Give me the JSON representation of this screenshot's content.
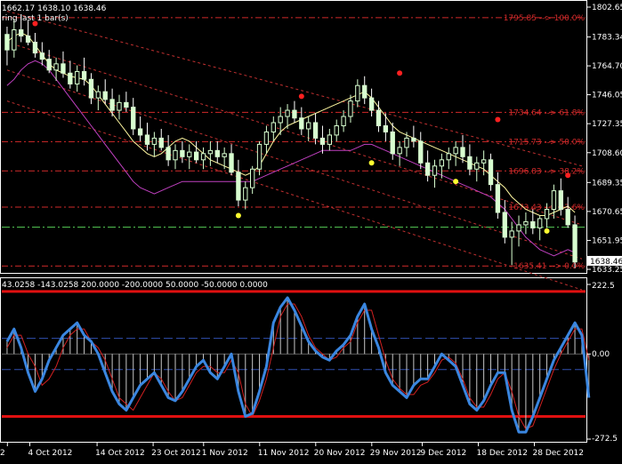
{
  "chart_data": [
    {
      "type": "candlestick",
      "header": "1662.17 1638.10 1638.46",
      "header2": "ring last 1 bar(s)",
      "y_ticks": [
        "1802.65",
        "1783.34",
        "1764.70",
        "1746.05",
        "1727.35",
        "1708.60",
        "1689.35",
        "1670.65",
        "1651.95",
        "1633.25"
      ],
      "ylim": [
        1633.25,
        1802.65
      ],
      "last_price": "1638.46",
      "colors": {
        "up": "#d8ffd0",
        "down": "#ffffff",
        "fib": "#d12a2a",
        "signal_red": "#ff2020",
        "signal_yellow": "#ffff30",
        "ma_purple": "#c040c0",
        "ma_yellow": "#fff8a0",
        "channel": "#c03030",
        "hline_green": "#50c050"
      },
      "fib_levels": [
        {
          "label": "1795.85 --> 100.0%",
          "value": 1795.85
        },
        {
          "label": "1734.64 --> 61.8%",
          "value": 1734.64
        },
        {
          "label": "1715.73 --> 50.0%",
          "value": 1715.73
        },
        {
          "label": "1696.83 --> 38.2%",
          "value": 1696.83
        },
        {
          "label": "1673.43 --> 23.6%",
          "value": 1673.43
        },
        {
          "label": "1635.41 --> 0.0%",
          "value": 1635.41
        }
      ],
      "hline_value": 1660.5,
      "candles": [
        [
          1785,
          1790,
          1765,
          1775
        ],
        [
          1775,
          1795,
          1770,
          1788
        ],
        [
          1788,
          1798,
          1780,
          1784
        ],
        [
          1784,
          1794,
          1778,
          1780
        ],
        [
          1780,
          1786,
          1770,
          1773
        ],
        [
          1773,
          1780,
          1765,
          1769
        ],
        [
          1769,
          1775,
          1760,
          1762
        ],
        [
          1762,
          1770,
          1755,
          1766
        ],
        [
          1766,
          1774,
          1757,
          1760
        ],
        [
          1760,
          1768,
          1750,
          1753
        ],
        [
          1753,
          1765,
          1748,
          1761
        ],
        [
          1761,
          1770,
          1752,
          1756
        ],
        [
          1756,
          1760,
          1740,
          1744
        ],
        [
          1744,
          1752,
          1736,
          1748
        ],
        [
          1748,
          1756,
          1740,
          1743
        ],
        [
          1743,
          1750,
          1732,
          1736
        ],
        [
          1736,
          1746,
          1730,
          1741
        ],
        [
          1741,
          1748,
          1735,
          1738
        ],
        [
          1738,
          1744,
          1720,
          1724
        ],
        [
          1724,
          1732,
          1716,
          1720
        ],
        [
          1720,
          1728,
          1710,
          1714
        ],
        [
          1714,
          1722,
          1706,
          1718
        ],
        [
          1718,
          1724,
          1710,
          1712
        ],
        [
          1712,
          1720,
          1700,
          1704
        ],
        [
          1704,
          1714,
          1698,
          1710
        ],
        [
          1710,
          1716,
          1702,
          1706
        ],
        [
          1706,
          1714,
          1698,
          1709
        ],
        [
          1709,
          1716,
          1702,
          1704
        ],
        [
          1704,
          1712,
          1698,
          1708
        ],
        [
          1708,
          1716,
          1700,
          1710
        ],
        [
          1710,
          1716,
          1702,
          1706
        ],
        [
          1706,
          1712,
          1698,
          1708
        ],
        [
          1708,
          1714,
          1694,
          1696
        ],
        [
          1696,
          1704,
          1674,
          1678
        ],
        [
          1678,
          1690,
          1672,
          1686
        ],
        [
          1686,
          1700,
          1682,
          1698
        ],
        [
          1698,
          1716,
          1694,
          1714
        ],
        [
          1714,
          1726,
          1708,
          1722
        ],
        [
          1722,
          1732,
          1716,
          1728
        ],
        [
          1728,
          1738,
          1720,
          1732
        ],
        [
          1732,
          1740,
          1724,
          1736
        ],
        [
          1736,
          1742,
          1728,
          1731
        ],
        [
          1731,
          1738,
          1720,
          1724
        ],
        [
          1724,
          1732,
          1716,
          1728
        ],
        [
          1728,
          1734,
          1714,
          1718
        ],
        [
          1718,
          1726,
          1708,
          1714
        ],
        [
          1714,
          1724,
          1710,
          1720
        ],
        [
          1720,
          1730,
          1716,
          1726
        ],
        [
          1726,
          1736,
          1722,
          1732
        ],
        [
          1732,
          1746,
          1728,
          1742
        ],
        [
          1742,
          1756,
          1738,
          1752
        ],
        [
          1752,
          1758,
          1740,
          1744
        ],
        [
          1744,
          1750,
          1732,
          1736
        ],
        [
          1736,
          1742,
          1722,
          1726
        ],
        [
          1726,
          1734,
          1716,
          1722
        ],
        [
          1722,
          1728,
          1704,
          1708
        ],
        [
          1708,
          1716,
          1700,
          1712
        ],
        [
          1712,
          1722,
          1706,
          1718
        ],
        [
          1718,
          1726,
          1712,
          1716
        ],
        [
          1716,
          1722,
          1698,
          1702
        ],
        [
          1702,
          1710,
          1690,
          1694
        ],
        [
          1694,
          1704,
          1686,
          1700
        ],
        [
          1700,
          1708,
          1692,
          1704
        ],
        [
          1704,
          1712,
          1698,
          1708
        ],
        [
          1708,
          1716,
          1700,
          1712
        ],
        [
          1712,
          1720,
          1702,
          1706
        ],
        [
          1706,
          1714,
          1694,
          1698
        ],
        [
          1698,
          1706,
          1690,
          1702
        ],
        [
          1702,
          1710,
          1694,
          1704
        ],
        [
          1704,
          1708,
          1684,
          1688
        ],
        [
          1688,
          1696,
          1666,
          1670
        ],
        [
          1670,
          1678,
          1650,
          1654
        ],
        [
          1654,
          1664,
          1636,
          1658
        ],
        [
          1658,
          1668,
          1648,
          1662
        ],
        [
          1662,
          1670,
          1656,
          1664
        ],
        [
          1664,
          1672,
          1656,
          1660
        ],
        [
          1660,
          1668,
          1652,
          1666
        ],
        [
          1666,
          1676,
          1660,
          1672
        ],
        [
          1672,
          1688,
          1666,
          1684
        ],
        [
          1684,
          1692,
          1668,
          1672
        ],
        [
          1672,
          1680,
          1660,
          1662
        ],
        [
          1662,
          1668,
          1634,
          1638
        ]
      ],
      "ma_yellow": [
        1780,
        1784,
        1786,
        1784,
        1778,
        1772,
        1766,
        1762,
        1760,
        1758,
        1757,
        1756,
        1752,
        1746,
        1740,
        1734,
        1728,
        1722,
        1716,
        1712,
        1708,
        1706,
        1708,
        1712,
        1716,
        1718,
        1716,
        1712,
        1708,
        1704,
        1702,
        1700,
        1698,
        1696,
        1694,
        1696,
        1700,
        1708,
        1716,
        1722,
        1726,
        1728,
        1730,
        1732,
        1734,
        1736,
        1738,
        1740,
        1742,
        1744,
        1746,
        1748,
        1744,
        1738,
        1732,
        1726,
        1722,
        1720,
        1718,
        1716,
        1714,
        1712,
        1710,
        1708,
        1706,
        1704,
        1702,
        1700,
        1698,
        1694,
        1690,
        1686,
        1680,
        1676,
        1672,
        1670,
        1668,
        1668,
        1670,
        1672,
        1674,
        1670
      ],
      "ma_purple": [
        1752,
        1756,
        1762,
        1766,
        1768,
        1766,
        1762,
        1756,
        1750,
        1744,
        1738,
        1732,
        1726,
        1720,
        1714,
        1708,
        1702,
        1696,
        1690,
        1686,
        1684,
        1682,
        1684,
        1686,
        1688,
        1690,
        1690,
        1690,
        1690,
        1690,
        1690,
        1690,
        1690,
        1690,
        1690,
        1690,
        1692,
        1694,
        1696,
        1698,
        1700,
        1702,
        1704,
        1706,
        1708,
        1710,
        1710,
        1710,
        1710,
        1710,
        1712,
        1714,
        1714,
        1712,
        1710,
        1708,
        1706,
        1704,
        1702,
        1700,
        1698,
        1696,
        1694,
        1692,
        1690,
        1688,
        1686,
        1684,
        1682,
        1680,
        1676,
        1672,
        1666,
        1660,
        1654,
        1650,
        1646,
        1644,
        1642,
        1644,
        1646,
        1644
      ],
      "signals": [
        {
          "i": 4,
          "color": "red",
          "value": 1792
        },
        {
          "i": 33,
          "color": "yellow",
          "value": 1668
        },
        {
          "i": 42,
          "color": "red",
          "value": 1745
        },
        {
          "i": 52,
          "color": "yellow",
          "value": 1702
        },
        {
          "i": 56,
          "color": "red",
          "value": 1760
        },
        {
          "i": 64,
          "color": "yellow",
          "value": 1690
        },
        {
          "i": 70,
          "color": "red",
          "value": 1730
        },
        {
          "i": 77,
          "color": "yellow",
          "value": 1658
        },
        {
          "i": 80,
          "color": "red",
          "value": 1694
        }
      ]
    },
    {
      "type": "oscillator",
      "header": "43.0258 -143.0258 200.0000 -200.0000 50.0000 -50.0000 0.0000",
      "ylim": [
        -272.5,
        222.5
      ],
      "y_ticks": [
        "222.5",
        "0.00",
        "-272.5"
      ],
      "levels": [
        200,
        -200,
        50,
        -50,
        0
      ],
      "colors": {
        "main": "#3a86e0",
        "signal": "#d02020",
        "level_red": "#e01010",
        "level_blue": "#3050b0"
      },
      "main": [
        40,
        80,
        20,
        -60,
        -120,
        -80,
        -20,
        20,
        60,
        80,
        100,
        60,
        40,
        0,
        -60,
        -120,
        -160,
        -180,
        -140,
        -100,
        -80,
        -60,
        -100,
        -140,
        -150,
        -120,
        -80,
        -40,
        -20,
        -60,
        -80,
        -40,
        0,
        -120,
        -200,
        -190,
        -120,
        -40,
        100,
        150,
        180,
        140,
        90,
        40,
        10,
        -10,
        -20,
        10,
        30,
        60,
        120,
        160,
        80,
        20,
        -60,
        -100,
        -120,
        -140,
        -100,
        -80,
        -80,
        -40,
        0,
        -20,
        -40,
        -100,
        -160,
        -180,
        -150,
        -100,
        -60,
        -60,
        -180,
        -250,
        -250,
        -200,
        -140,
        -80,
        -20,
        20,
        60,
        100,
        60,
        -140
      ],
      "signal": [
        20,
        60,
        60,
        0,
        -40,
        -100,
        -80,
        -40,
        20,
        60,
        80,
        80,
        40,
        20,
        -20,
        -80,
        -140,
        -160,
        -180,
        -140,
        -100,
        -60,
        -80,
        -120,
        -150,
        -140,
        -100,
        -60,
        -40,
        -40,
        -60,
        -60,
        -20,
        -60,
        -160,
        -200,
        -150,
        -80,
        20,
        120,
        160,
        160,
        120,
        60,
        20,
        0,
        -20,
        -10,
        20,
        40,
        100,
        140,
        140,
        60,
        -20,
        -80,
        -110,
        -130,
        -130,
        -100,
        -90,
        -60,
        -20,
        -10,
        -30,
        -80,
        -140,
        -170,
        -170,
        -130,
        -80,
        -60,
        -120,
        -200,
        -240,
        -230,
        -170,
        -110,
        -50,
        0,
        40,
        80,
        80,
        -20
      ],
      "x_labels": [
        "2",
        "4 Oct 2012",
        "14 Oct 2012",
        "23 Oct 2012",
        "1 Nov 2012",
        "11 Nov 2012",
        "20 Nov 2012",
        "29 Nov 2012",
        "9 Dec 2012",
        "18 Dec 2012",
        "28 Dec 2012"
      ]
    }
  ]
}
